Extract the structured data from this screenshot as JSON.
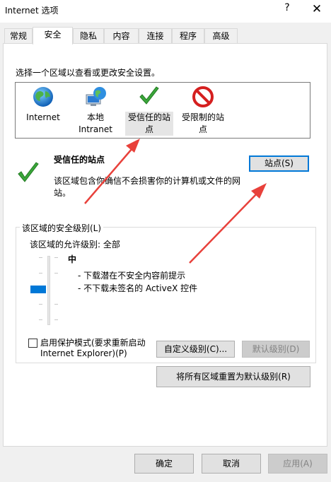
{
  "window": {
    "title": "Internet 选项",
    "help_label": "?",
    "close_label": "✕"
  },
  "tabs": [
    {
      "label": "常规"
    },
    {
      "label": "安全"
    },
    {
      "label": "隐私"
    },
    {
      "label": "内容"
    },
    {
      "label": "连接"
    },
    {
      "label": "程序"
    },
    {
      "label": "高级"
    }
  ],
  "security": {
    "zone_prompt": "选择一个区域以查看或更改安全设置。",
    "zones": [
      {
        "label_line1": "Internet",
        "label_line2": "",
        "icon": "globe-icon"
      },
      {
        "label_line1": "本地",
        "label_line2": "Intranet",
        "icon": "local-intranet-icon"
      },
      {
        "label_line1": "受信任的站",
        "label_line2": "点",
        "icon": "checkmark-icon"
      },
      {
        "label_line1": "受限制的站",
        "label_line2": "点",
        "icon": "restricted-icon"
      }
    ],
    "selected_zone_title": "受信任的站点",
    "selected_zone_desc_line1": "该区域包含你确信不会损害你的计算机或文件的网",
    "selected_zone_desc_line2": "站。",
    "sites_button": "站点(S)",
    "level_group_title": "该区域的安全级别(L)",
    "allowed_levels": "该区域的允许级别: 全部",
    "level_name": "中",
    "level_desc_line1": "- 下载潜在不安全内容前提示",
    "level_desc_line2": "- 不下载未签名的 ActiveX 控件",
    "protected_mode_line1": "启用保护模式(要求重新启动",
    "protected_mode_line2": "Internet Explorer)(P)",
    "protected_mode_checked": false,
    "custom_level_button": "自定义级别(C)...",
    "default_level_button": "默认级别(D)",
    "reset_all_button": "将所有区域重置为默认级别(R)",
    "slider_level_fraction": 0.5
  },
  "footer": {
    "ok": "确定",
    "cancel": "取消",
    "apply": "应用(A)"
  },
  "colors": {
    "accent": "#0078d7",
    "annotation_arrow": "#e8413b"
  }
}
